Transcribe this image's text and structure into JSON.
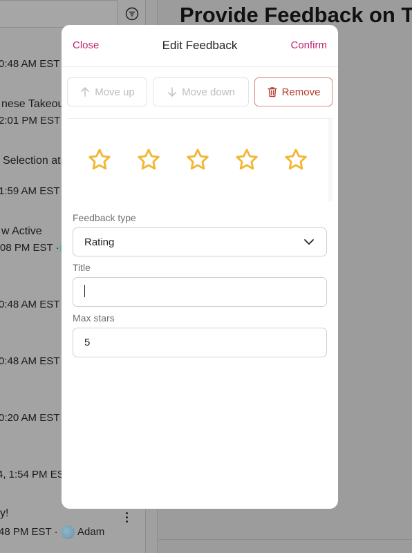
{
  "background": {
    "heading": "Provide Feedback on To",
    "list_items": [
      {
        "meta": "0:48 AM EST ·"
      },
      {
        "title": "nese Takeout",
        "meta": "2:01 PM EST ·"
      },
      {
        "title": "Selection at",
        "meta": "1:59 AM EST ·"
      },
      {
        "title": "w Active",
        "meta": "08 PM EST ·"
      },
      {
        "meta": "0:48 AM EST"
      },
      {
        "meta": "0:48 AM EST"
      },
      {
        "meta": "0:20 AM EST"
      },
      {
        "meta": "4, 1:54 PM EST"
      },
      {
        "title": "y!",
        "meta": "48 PM EST ·",
        "author": "Adam"
      }
    ]
  },
  "modal": {
    "close_label": "Close",
    "title": "Edit Feedback",
    "confirm_label": "Confirm",
    "toolbar": {
      "move_up": "Move up",
      "move_down": "Move down",
      "remove": "Remove"
    },
    "preview": {
      "star_count": 5,
      "star_color": "#f2b630"
    },
    "form": {
      "feedback_type_label": "Feedback type",
      "feedback_type_value": "Rating",
      "title_label": "Title",
      "title_value": "",
      "max_stars_label": "Max stars",
      "max_stars_value": "5"
    }
  },
  "colors": {
    "accent": "#c0246f",
    "danger": "#b23d2d",
    "overlay": "#9b9b9b"
  }
}
